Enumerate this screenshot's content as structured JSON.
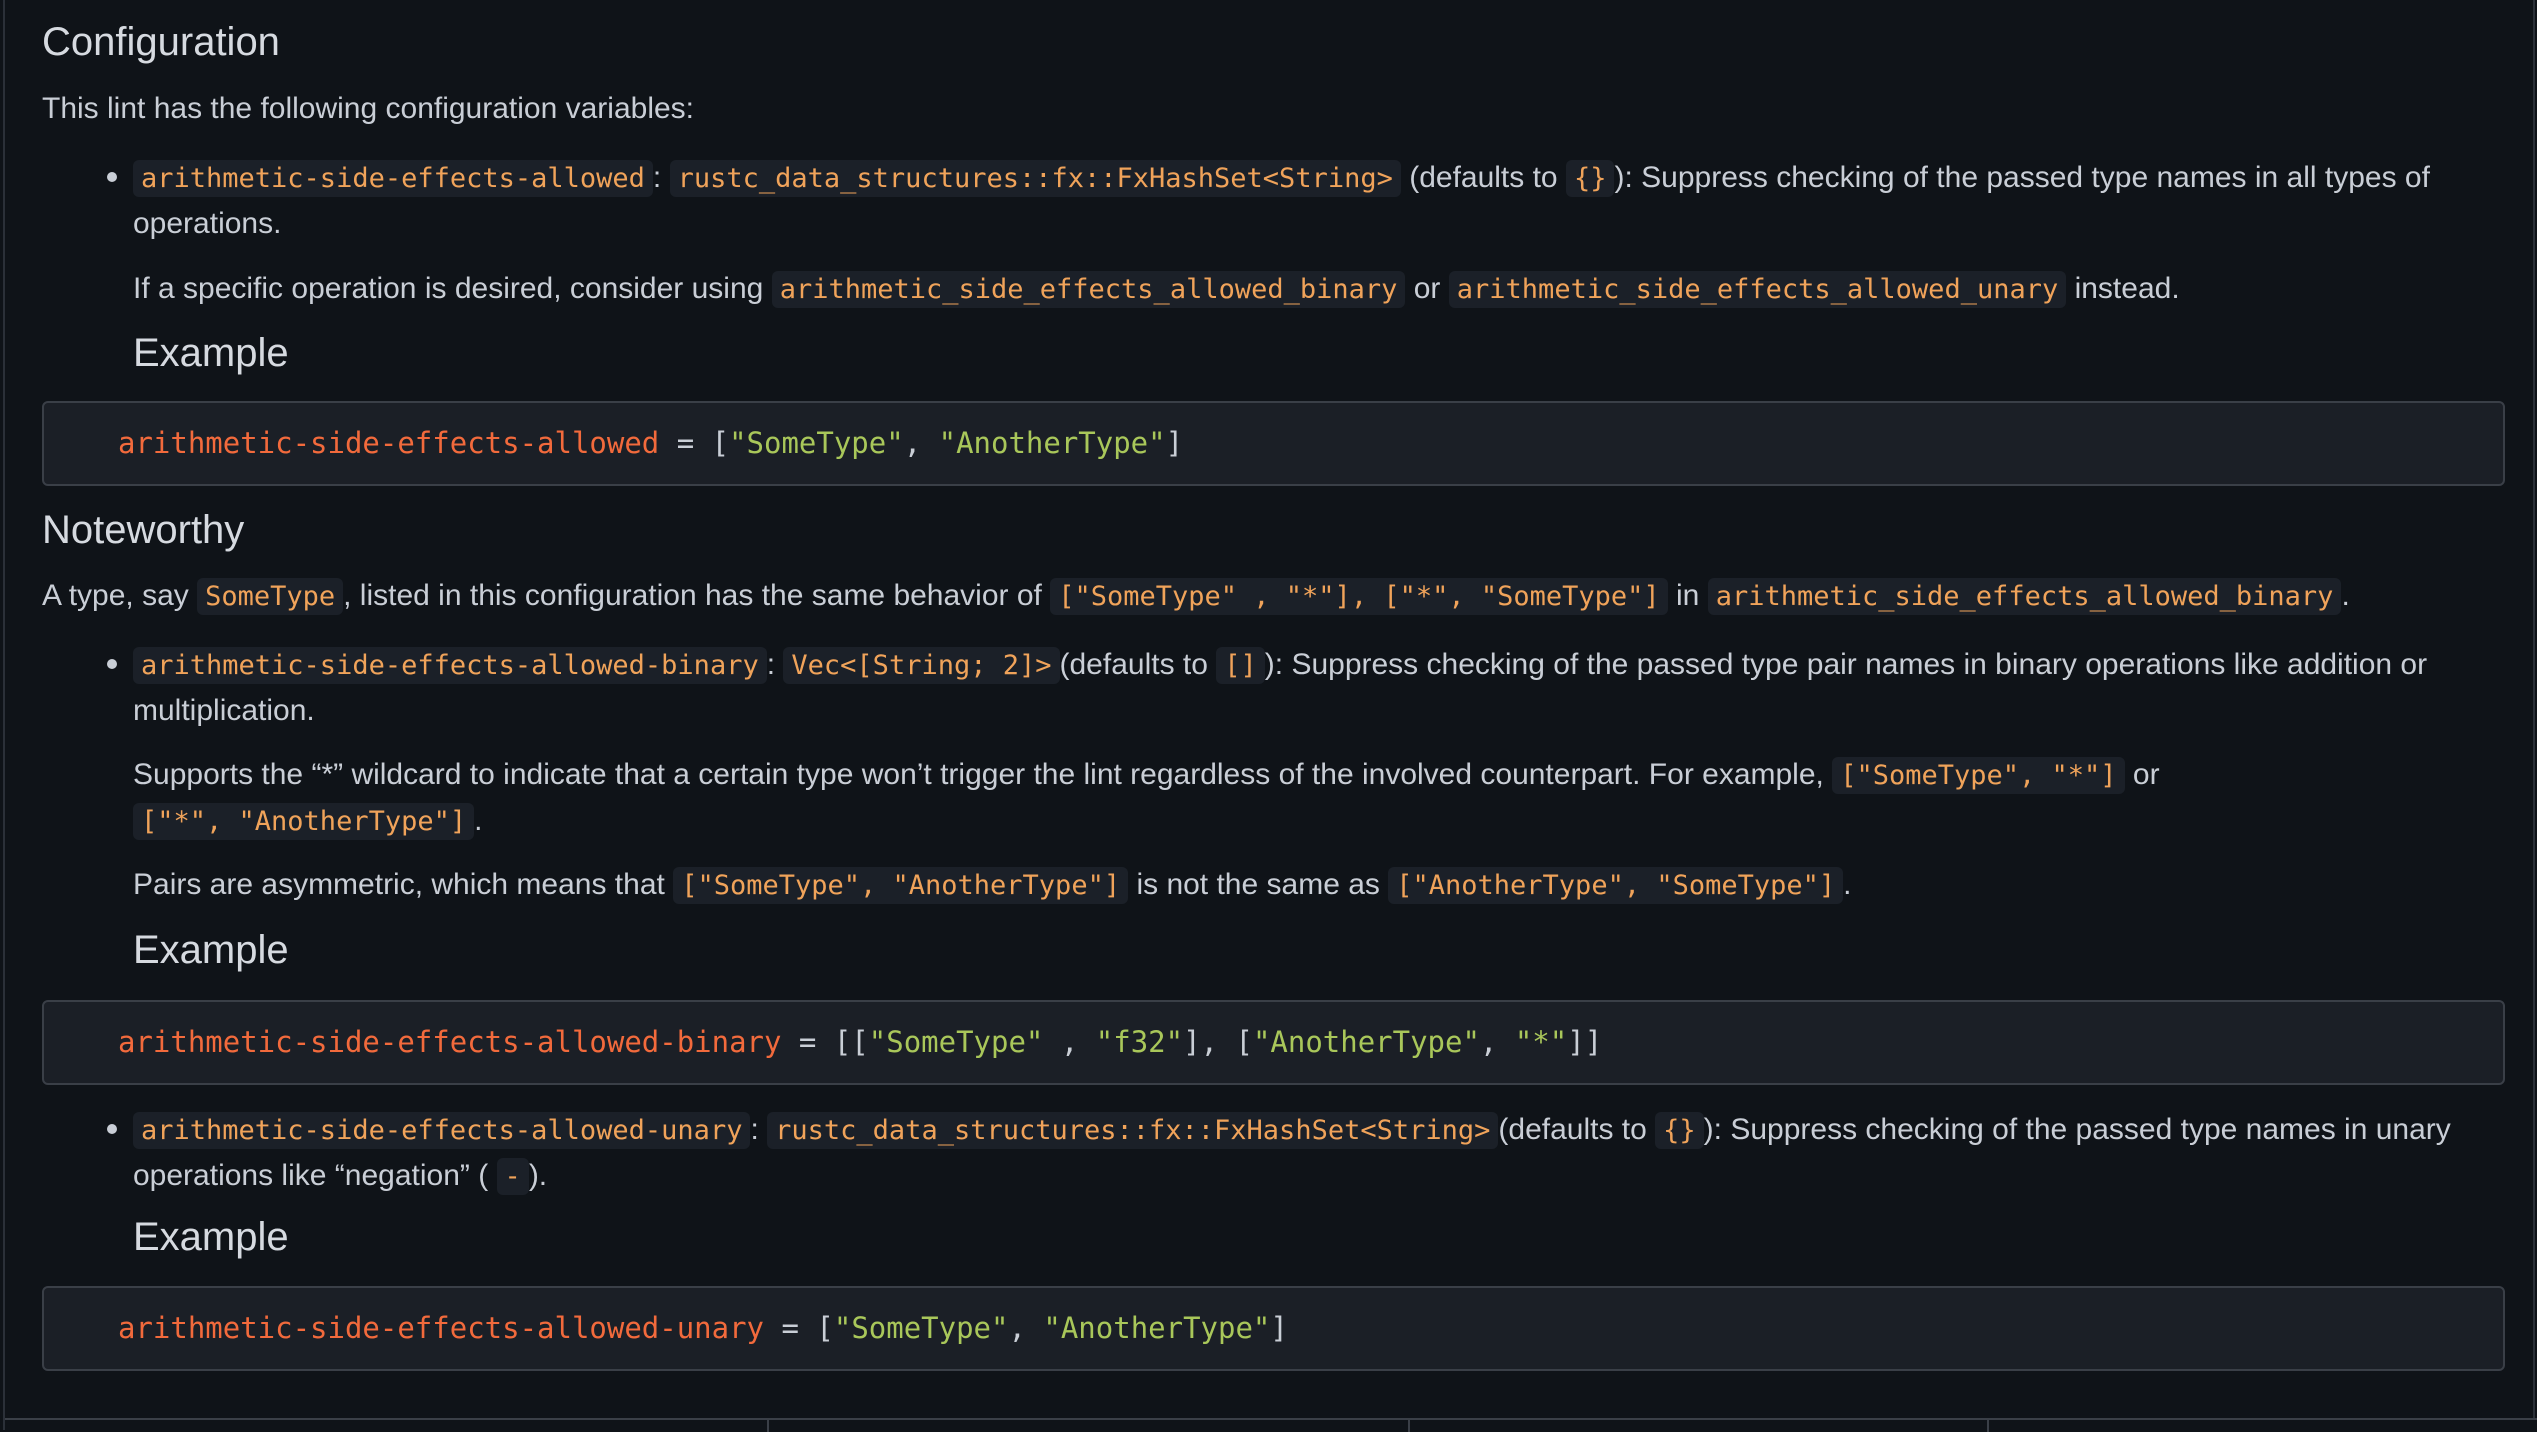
{
  "configuration": {
    "heading": "Configuration",
    "intro": "This lint has the following configuration variables:",
    "item1": {
      "name": "arithmetic-side-effects-allowed",
      "colon": ":",
      "type": "rustc_data_structures::fx::FxHashSet<String>",
      "defaults_pre": "(defaults to",
      "default": "{}",
      "desc": "): Suppress checking of the passed type names in all types of operations.",
      "para_pre": "If a specific operation is desired, consider using",
      "code_a": "arithmetic_side_effects_allowed_binary",
      "or": "or",
      "code_b": "arithmetic_side_effects_allowed_unary",
      "para_post": "instead.",
      "example_heading": "Example",
      "example": {
        "key": "arithmetic-side-effects-allowed",
        "eq": " = [",
        "v1": "\"SomeType\"",
        "sep": ", ",
        "v2": "\"AnotherType\"",
        "end": "]"
      }
    }
  },
  "noteworthy": {
    "heading": "Noteworthy",
    "t1": "A type, say",
    "c1": "SomeType",
    "t2": ", listed in this configuration has the same behavior of",
    "c2": "[\"SomeType\" , \"*\"], [\"*\", \"SomeType\"]",
    "t3": "in",
    "c3": "arithmetic_side_effects_allowed_binary",
    "t4": "."
  },
  "item2": {
    "name": "arithmetic-side-effects-allowed-binary",
    "colon": ":",
    "type": "Vec<[String; 2]>",
    "defaults_pre": "(defaults to",
    "default": "[]",
    "desc": "): Suppress checking of the passed type pair names in binary operations like addition or multiplication.",
    "p2_pre": "Supports the “*” wildcard to indicate that a certain type won’t trigger the lint regardless of the involved counterpart. For example,",
    "p2_c1": "[\"SomeType\", \"*\"]",
    "p2_or": "or",
    "p2_c2": "[\"*\", \"AnotherType\"]",
    "p2_end": ".",
    "p3_pre": "Pairs are asymmetric, which means that",
    "p3_c1": "[\"SomeType\", \"AnotherType\"]",
    "p3_mid": "is not the same as",
    "p3_c2": "[\"AnotherType\", \"SomeType\"]",
    "p3_end": ".",
    "example_heading": "Example",
    "example": {
      "key": "arithmetic-side-effects-allowed-binary",
      "eq": " = [[",
      "v1": "\"SomeType\"",
      "s1": " , ",
      "v2": "\"f32\"",
      "s2": "], [",
      "v3": "\"AnotherType\"",
      "s3": ", ",
      "v4": "\"*\"",
      "end": "]]"
    }
  },
  "item3": {
    "name": "arithmetic-side-effects-allowed-unary",
    "colon": ":",
    "type": "rustc_data_structures::fx::FxHashSet<String>",
    "defaults_pre": "(defaults to",
    "default": "{}",
    "desc": "): Suppress checking of the passed type names in unary operations like “negation” (",
    "neg": "-",
    "desc_end": ").",
    "example_heading": "Example",
    "example": {
      "key": "arithmetic-side-effects-allowed-unary",
      "eq": " = [",
      "v1": "\"SomeType\"",
      "sep": ", ",
      "v2": "\"AnotherType\"",
      "end": "]"
    }
  },
  "colors": {
    "background": "#0f1318",
    "text": "#c9ced6",
    "inline_code": "#f0a35a",
    "code_key": "#f26a3c",
    "code_string": "#a9c75a"
  }
}
